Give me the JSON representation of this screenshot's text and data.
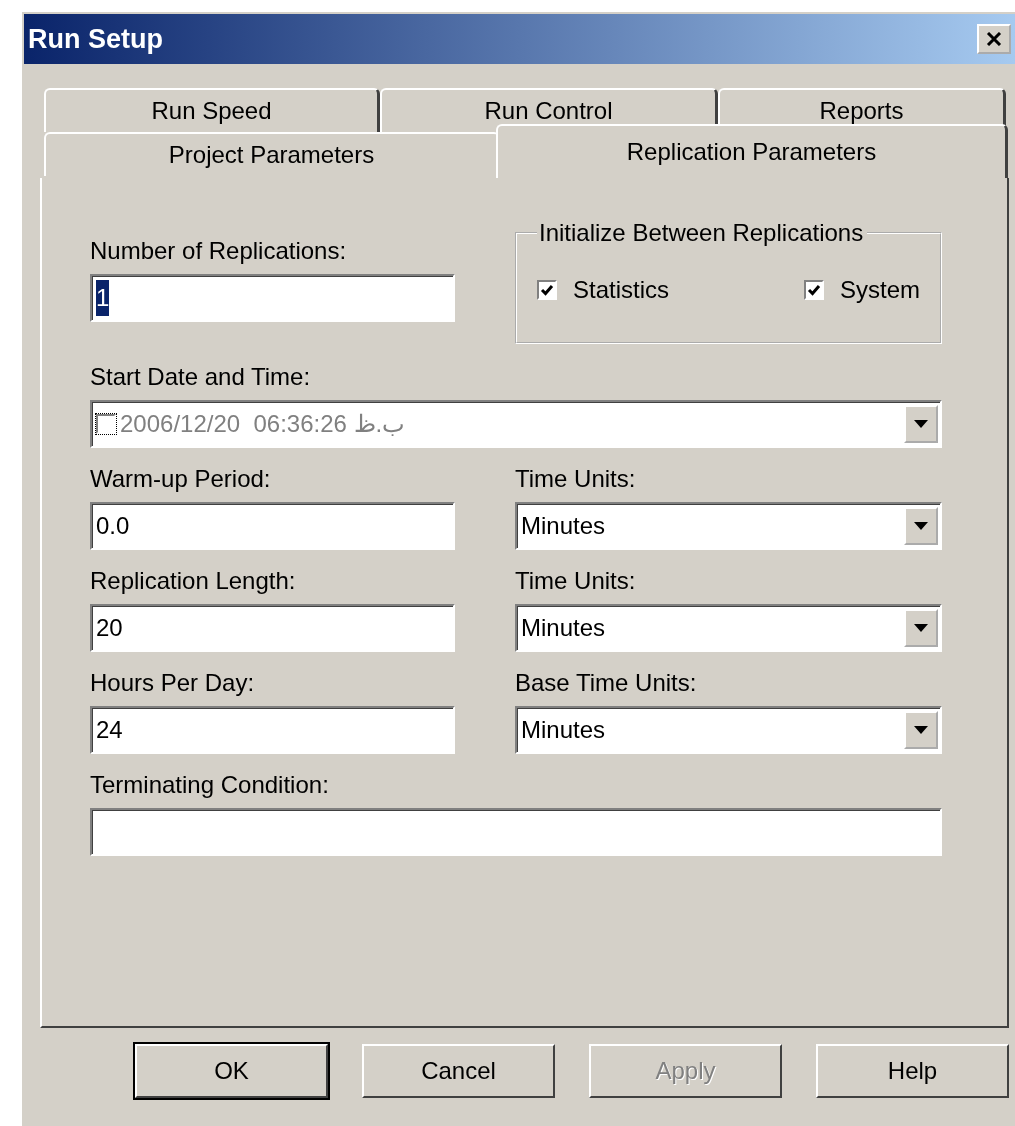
{
  "window": {
    "title": "Run Setup"
  },
  "tab_rows": [
    [
      {
        "label": "Run Speed",
        "selected": false
      },
      {
        "label": "Run Control",
        "selected": false
      },
      {
        "label": "Reports",
        "selected": false
      }
    ],
    [
      {
        "label": "Project Parameters",
        "selected": false
      },
      {
        "label": "Replication Parameters",
        "selected": true
      }
    ]
  ],
  "number_of_replications": {
    "label": "Number of Replications:",
    "value": "1",
    "highlighted": true
  },
  "initialize_group": {
    "title": "Initialize Between Replications",
    "options": [
      {
        "label": "Statistics",
        "checked": true
      },
      {
        "label": "System",
        "checked": true
      }
    ]
  },
  "start_date": {
    "label": "Start Date and Time:",
    "value": "2006/12/20  06:36:26 ب.ظ",
    "checked": false,
    "disabled": true
  },
  "rows": [
    {
      "label": "Warm-up Period:",
      "value": "0.0",
      "unit_label": "Time Units:",
      "unit": "Minutes"
    },
    {
      "label": "Replication Length:",
      "value": "20",
      "unit_label": "Time Units:",
      "unit": "Minutes"
    },
    {
      "label": "Hours Per Day:",
      "value": "24",
      "unit_label": "Base Time Units:",
      "unit": "Minutes"
    }
  ],
  "terminating_condition": {
    "label": "Terminating Condition:"
  },
  "buttons": [
    {
      "label": "OK",
      "default": true,
      "disabled": false
    },
    {
      "label": "Cancel",
      "default": false,
      "disabled": false
    },
    {
      "label": "Apply",
      "default": false,
      "disabled": true
    },
    {
      "label": "Help",
      "default": false,
      "disabled": false
    }
  ]
}
